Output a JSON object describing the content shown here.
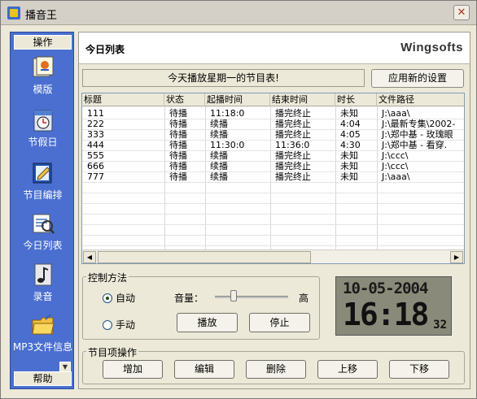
{
  "window": {
    "title": "播音王",
    "close_glyph": "✕"
  },
  "sidebar": {
    "header": "操作",
    "footer": "帮助",
    "scroll_glyph": "▼",
    "items": [
      {
        "label": "模版",
        "icon": "template-icon"
      },
      {
        "label": "节假日",
        "icon": "holiday-clock-icon"
      },
      {
        "label": "节目编排",
        "icon": "program-edit-icon"
      },
      {
        "label": "今日列表",
        "icon": "today-list-icon"
      },
      {
        "label": "录音",
        "icon": "recording-note-icon"
      },
      {
        "label": "MP3文件信息",
        "icon": "mp3-folder-icon"
      }
    ]
  },
  "main": {
    "title": "今日列表",
    "brand": "Wingsofts",
    "notice": "今天播放星期一的节目表!",
    "apply_button": "应用新的设置"
  },
  "table": {
    "columns": [
      "标题",
      "状态",
      "起播时间",
      "结束时间",
      "时长",
      "文件路径"
    ],
    "rows": [
      [
        "111",
        "待播",
        "11:18:0",
        "播完终止",
        "未知",
        "J:\\aaa\\"
      ],
      [
        "222",
        "待播",
        "续播",
        "播完终止",
        "4:04",
        "J:\\最新专集\\2002-"
      ],
      [
        "333",
        "待播",
        "续播",
        "播完终止",
        "4:05",
        "J:\\郑中基 - 玫瑰眼"
      ],
      [
        "444",
        "待播",
        "11:30:0",
        "11:36:0",
        "4:30",
        "J:\\郑中基 - 看穿."
      ],
      [
        "555",
        "待播",
        "续播",
        "播完终止",
        "未知",
        "J:\\ccc\\"
      ],
      [
        "666",
        "待播",
        "续播",
        "播完终止",
        "未知",
        "J:\\ccc\\"
      ],
      [
        "777",
        "待播",
        "续播",
        "播完终止",
        "未知",
        "J:\\aaa\\"
      ]
    ],
    "scroll_left": "◀",
    "scroll_right": "▶"
  },
  "control": {
    "legend": "控制方法",
    "auto_label": "自动",
    "manual_label": "手动",
    "mode_selected": "auto",
    "volume_label": "音量：",
    "volume_high": "高",
    "volume_level": 0.25,
    "play_button": "播放",
    "stop_button": "停止"
  },
  "clock": {
    "date": "10-05-2004",
    "time": "16:18",
    "seconds": "32"
  },
  "program_ops": {
    "legend": "节目项操作",
    "add": "增加",
    "edit": "编辑",
    "delete": "删除",
    "move_up": "上移",
    "move_down": "下移"
  }
}
